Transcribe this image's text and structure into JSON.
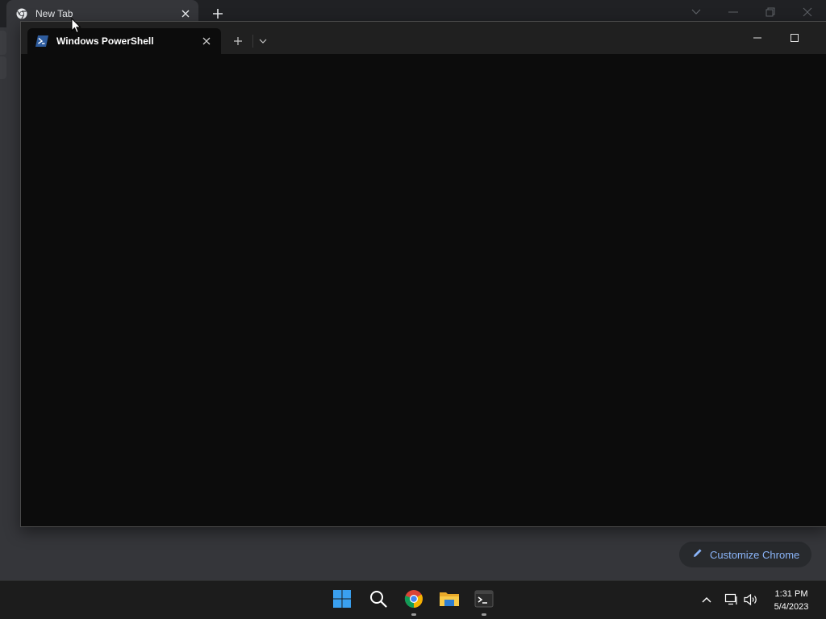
{
  "chrome": {
    "tab_title": "New Tab",
    "customize_label": "Customize Chrome",
    "accent_color": "#8ab4f8"
  },
  "terminal": {
    "tab_title": "Windows PowerShell",
    "background_color": "#0c0c0c"
  },
  "taskbar": {
    "apps": [
      {
        "name": "start",
        "icon": "windows-logo-icon"
      },
      {
        "name": "search",
        "icon": "search-icon"
      },
      {
        "name": "chrome",
        "icon": "chrome-icon",
        "running": true
      },
      {
        "name": "file-explorer",
        "icon": "folder-icon"
      },
      {
        "name": "terminal",
        "icon": "terminal-icon",
        "running": true
      }
    ],
    "clock": {
      "time": "1:31 PM",
      "date": "5/4/2023"
    }
  }
}
